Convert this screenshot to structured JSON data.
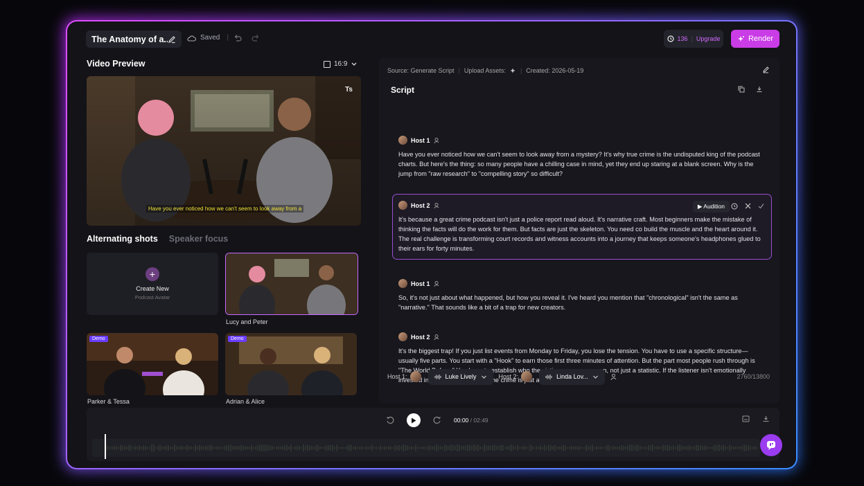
{
  "topbar": {
    "project_title": "The Anatomy of a...",
    "saved_label": "Saved",
    "credits": "136",
    "upgrade_label": "Upgrade",
    "render_label": "Render"
  },
  "preview": {
    "title": "Video Preview",
    "aspect_ratio": "16:9",
    "caption": "Have you ever noticed how we can't seem to look away from a"
  },
  "shots": {
    "tabs": [
      "Alternating shots",
      "Speaker focus"
    ],
    "create_title": "Create New",
    "create_subtitle": "Podcast Avatar",
    "cards": [
      {
        "label": "Lucy and Peter"
      },
      {
        "label": "Parker & Tessa",
        "badge": "Demo"
      },
      {
        "label": "Adrian & Alice",
        "badge": "Demo"
      }
    ]
  },
  "script": {
    "meta_source": "Source: Generate Script",
    "meta_upload": "Upload Assets:",
    "meta_created": "Created: 2026-05-19",
    "title": "Script",
    "audition_label": "Audition",
    "segments": [
      {
        "host": "Host 1",
        "text": "Have you ever noticed how we can't seem to look away from a mystery? It's why true crime is the undisputed king of the podcast charts. But here's the thing: so many people have a chilling case in mind, yet they end up staring at a blank screen. Why is the jump from \"raw research\" to \"compelling story\" so difficult?"
      },
      {
        "host": "Host 2",
        "text": "It's because a great crime podcast isn't just a police report read aloud. It's narrative craft. Most beginners make the mistake of thinking the facts will do the work for them. But facts are just the skeleton. You need co build the muscle and the heart around it. The real challenge is transforming court records and witness accounts into a journey that keeps someone's headphones glued to their ears for forty minutes."
      },
      {
        "host": "Host 1",
        "text": "So, it's not just about what happened, but how you reveal it. I've heard you mention that \"chronological\" isn't the same as \"narrative.\" That sounds like a bit of a trap for new creators."
      },
      {
        "host": "Host 2",
        "text": "It's the biggest trap! If you just list events from Monday to Friday, you lose the tension. You have to use a specific structure—usually five parts. You start with a \"Hook\" to earn those first three minutes of attention. But the part most people rush through is \"The World Before.\" You have to establish who the victim was as a person, not just a statistic. If the listener isn't emotionally invested in the life that was lost, the crime is just an incident, not a story."
      }
    ],
    "voices": {
      "host1_label": "Host 1:",
      "host1_voice": "Luke Lively",
      "host2_label": "Host 2:",
      "host2_voice": "Linda Lov...",
      "char_count": "2760/13800"
    }
  },
  "player": {
    "current_time": "00:00",
    "duration": "/ 02:49"
  }
}
